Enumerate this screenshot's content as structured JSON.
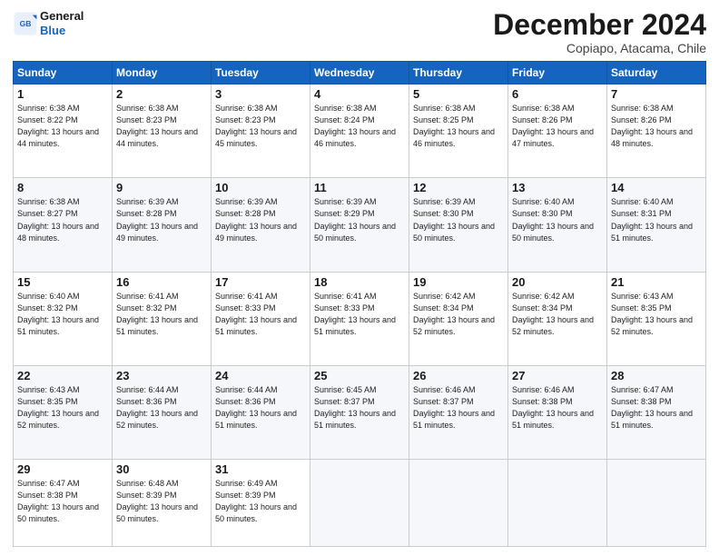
{
  "logo": {
    "line1": "General",
    "line2": "Blue"
  },
  "title": "December 2024",
  "subtitle": "Copiapo, Atacama, Chile",
  "headers": [
    "Sunday",
    "Monday",
    "Tuesday",
    "Wednesday",
    "Thursday",
    "Friday",
    "Saturday"
  ],
  "weeks": [
    [
      {
        "day": "1",
        "sunrise": "6:38 AM",
        "sunset": "8:22 PM",
        "daylight": "13 hours and 44 minutes."
      },
      {
        "day": "2",
        "sunrise": "6:38 AM",
        "sunset": "8:23 PM",
        "daylight": "13 hours and 44 minutes."
      },
      {
        "day": "3",
        "sunrise": "6:38 AM",
        "sunset": "8:23 PM",
        "daylight": "13 hours and 45 minutes."
      },
      {
        "day": "4",
        "sunrise": "6:38 AM",
        "sunset": "8:24 PM",
        "daylight": "13 hours and 46 minutes."
      },
      {
        "day": "5",
        "sunrise": "6:38 AM",
        "sunset": "8:25 PM",
        "daylight": "13 hours and 46 minutes."
      },
      {
        "day": "6",
        "sunrise": "6:38 AM",
        "sunset": "8:26 PM",
        "daylight": "13 hours and 47 minutes."
      },
      {
        "day": "7",
        "sunrise": "6:38 AM",
        "sunset": "8:26 PM",
        "daylight": "13 hours and 48 minutes."
      }
    ],
    [
      {
        "day": "8",
        "sunrise": "6:38 AM",
        "sunset": "8:27 PM",
        "daylight": "13 hours and 48 minutes."
      },
      {
        "day": "9",
        "sunrise": "6:39 AM",
        "sunset": "8:28 PM",
        "daylight": "13 hours and 49 minutes."
      },
      {
        "day": "10",
        "sunrise": "6:39 AM",
        "sunset": "8:28 PM",
        "daylight": "13 hours and 49 minutes."
      },
      {
        "day": "11",
        "sunrise": "6:39 AM",
        "sunset": "8:29 PM",
        "daylight": "13 hours and 50 minutes."
      },
      {
        "day": "12",
        "sunrise": "6:39 AM",
        "sunset": "8:30 PM",
        "daylight": "13 hours and 50 minutes."
      },
      {
        "day": "13",
        "sunrise": "6:40 AM",
        "sunset": "8:30 PM",
        "daylight": "13 hours and 50 minutes."
      },
      {
        "day": "14",
        "sunrise": "6:40 AM",
        "sunset": "8:31 PM",
        "daylight": "13 hours and 51 minutes."
      }
    ],
    [
      {
        "day": "15",
        "sunrise": "6:40 AM",
        "sunset": "8:32 PM",
        "daylight": "13 hours and 51 minutes."
      },
      {
        "day": "16",
        "sunrise": "6:41 AM",
        "sunset": "8:32 PM",
        "daylight": "13 hours and 51 minutes."
      },
      {
        "day": "17",
        "sunrise": "6:41 AM",
        "sunset": "8:33 PM",
        "daylight": "13 hours and 51 minutes."
      },
      {
        "day": "18",
        "sunrise": "6:41 AM",
        "sunset": "8:33 PM",
        "daylight": "13 hours and 51 minutes."
      },
      {
        "day": "19",
        "sunrise": "6:42 AM",
        "sunset": "8:34 PM",
        "daylight": "13 hours and 52 minutes."
      },
      {
        "day": "20",
        "sunrise": "6:42 AM",
        "sunset": "8:34 PM",
        "daylight": "13 hours and 52 minutes."
      },
      {
        "day": "21",
        "sunrise": "6:43 AM",
        "sunset": "8:35 PM",
        "daylight": "13 hours and 52 minutes."
      }
    ],
    [
      {
        "day": "22",
        "sunrise": "6:43 AM",
        "sunset": "8:35 PM",
        "daylight": "13 hours and 52 minutes."
      },
      {
        "day": "23",
        "sunrise": "6:44 AM",
        "sunset": "8:36 PM",
        "daylight": "13 hours and 52 minutes."
      },
      {
        "day": "24",
        "sunrise": "6:44 AM",
        "sunset": "8:36 PM",
        "daylight": "13 hours and 51 minutes."
      },
      {
        "day": "25",
        "sunrise": "6:45 AM",
        "sunset": "8:37 PM",
        "daylight": "13 hours and 51 minutes."
      },
      {
        "day": "26",
        "sunrise": "6:46 AM",
        "sunset": "8:37 PM",
        "daylight": "13 hours and 51 minutes."
      },
      {
        "day": "27",
        "sunrise": "6:46 AM",
        "sunset": "8:38 PM",
        "daylight": "13 hours and 51 minutes."
      },
      {
        "day": "28",
        "sunrise": "6:47 AM",
        "sunset": "8:38 PM",
        "daylight": "13 hours and 51 minutes."
      }
    ],
    [
      {
        "day": "29",
        "sunrise": "6:47 AM",
        "sunset": "8:38 PM",
        "daylight": "13 hours and 50 minutes."
      },
      {
        "day": "30",
        "sunrise": "6:48 AM",
        "sunset": "8:39 PM",
        "daylight": "13 hours and 50 minutes."
      },
      {
        "day": "31",
        "sunrise": "6:49 AM",
        "sunset": "8:39 PM",
        "daylight": "13 hours and 50 minutes."
      },
      null,
      null,
      null,
      null
    ]
  ]
}
